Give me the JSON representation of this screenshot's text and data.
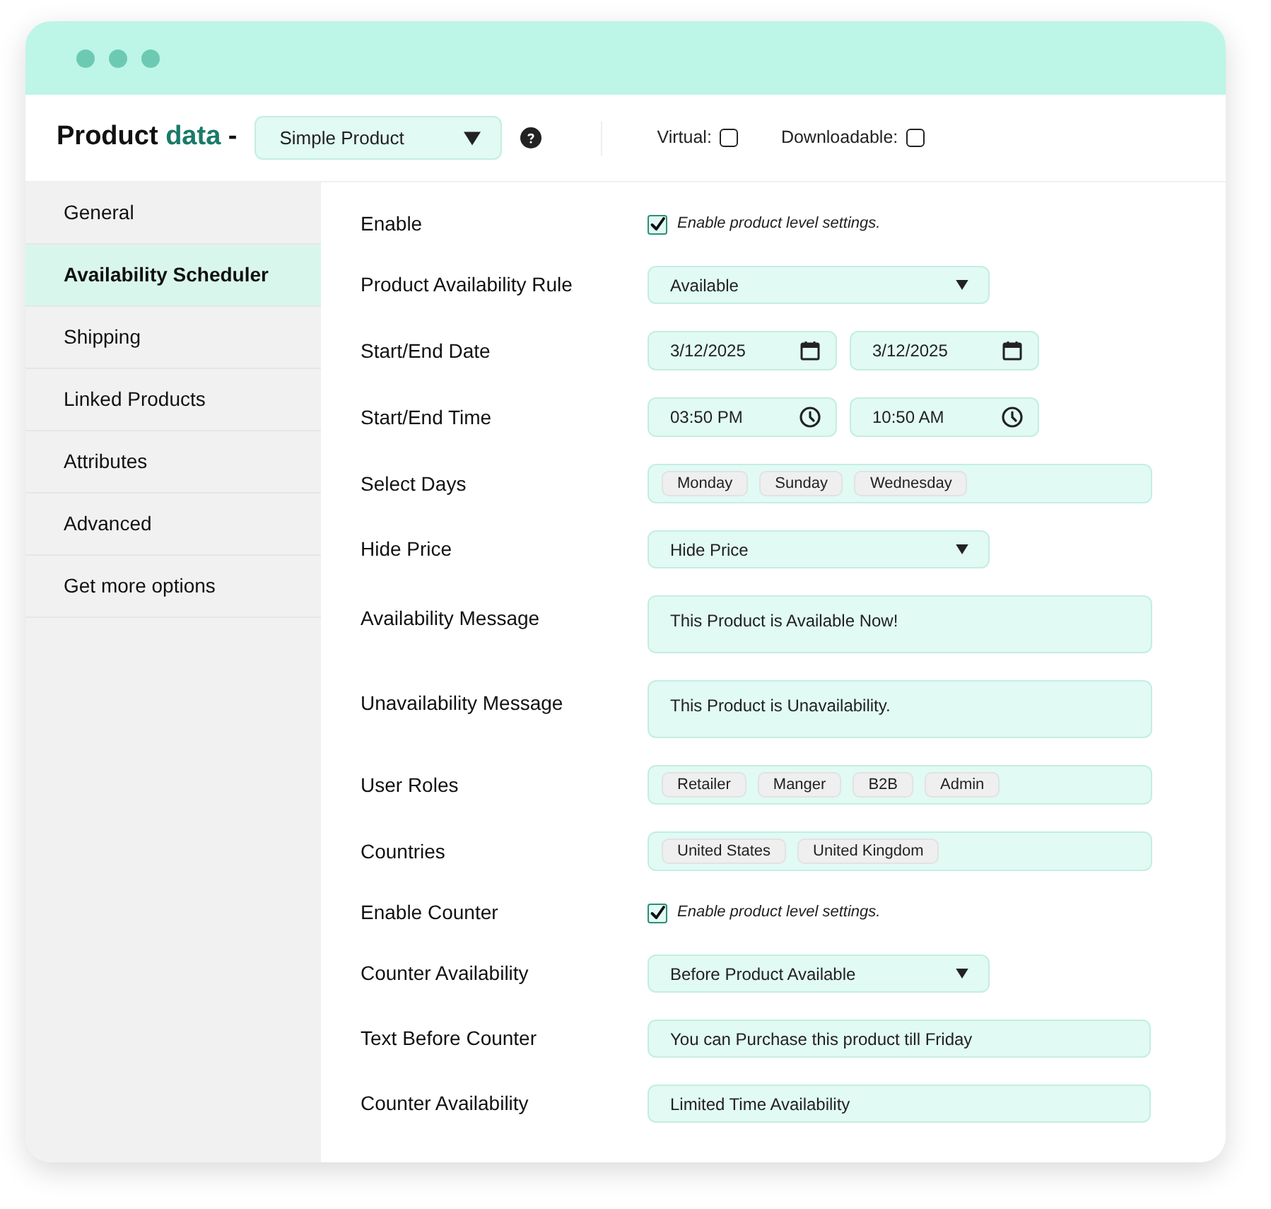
{
  "header": {
    "title": "Product",
    "title_accent": "data",
    "title_dash": "-",
    "product_type": "Simple Product",
    "options": [
      {
        "label": "Virtual:",
        "checked": false
      },
      {
        "label": "Downloadable:",
        "checked": false
      }
    ]
  },
  "sidebar": {
    "items": [
      {
        "label": "General",
        "selected": false
      },
      {
        "label": "Availability Scheduler",
        "selected": true
      },
      {
        "label": "Shipping",
        "selected": false
      },
      {
        "label": "Linked Products",
        "selected": false
      },
      {
        "label": "Attributes",
        "selected": false
      },
      {
        "label": "Advanced",
        "selected": false
      },
      {
        "label": "Get more options",
        "selected": false
      }
    ]
  },
  "fields": [
    {
      "kind": "checkbox",
      "label": "Enable",
      "text": "Enable product level settings.",
      "checked": true
    },
    {
      "kind": "select",
      "label": "Product Availability Rule",
      "value": "Available"
    },
    {
      "kind": "date",
      "label": "Start/End Date",
      "values": [
        "3/12/2025",
        "3/12/2025"
      ]
    },
    {
      "kind": "time",
      "label": "Start/End Time",
      "values": [
        "03:50 PM",
        "10:50 AM"
      ]
    },
    {
      "kind": "tags",
      "label": "Select Days",
      "tags": [
        "Monday",
        "Sunday",
        "Wednesday"
      ]
    },
    {
      "kind": "select",
      "label": "Hide Price",
      "value": "Hide Price"
    },
    {
      "kind": "textarea",
      "label": "Availability Message",
      "value": "This Product is Available Now!"
    },
    {
      "kind": "textarea",
      "label": "Unavailability Message",
      "value": "This Product is Unavailability."
    },
    {
      "kind": "tags",
      "label": "User Roles",
      "tags": [
        "Retailer",
        "Manger",
        "B2B",
        "Admin"
      ]
    },
    {
      "kind": "tags",
      "label": "Countries",
      "tags": [
        "United States",
        "United Kingdom"
      ]
    },
    {
      "kind": "checkbox",
      "label": "Enable Counter",
      "text": "Enable product level settings.",
      "checked": true
    },
    {
      "kind": "select",
      "label": "Counter Availability",
      "value": "Before Product Available"
    },
    {
      "kind": "text",
      "label": "Text Before Counter",
      "value": "You can Purchase this product till Friday"
    },
    {
      "kind": "text",
      "label": "Counter Availability",
      "value": "Limited Time Availability"
    }
  ]
}
